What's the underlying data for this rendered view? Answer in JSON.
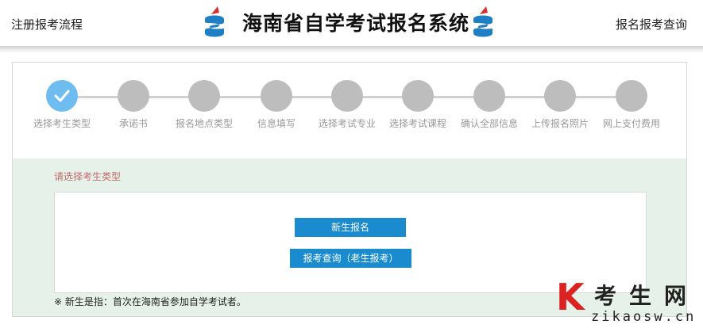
{
  "header": {
    "left_link": "注册报考流程",
    "title": "海南省自学考试报名系统",
    "right_link": "报名报考查询"
  },
  "steps": [
    {
      "label": "选择考生类型",
      "active": true
    },
    {
      "label": "承诺书",
      "active": false
    },
    {
      "label": "报名地点类型",
      "active": false
    },
    {
      "label": "信息填写",
      "active": false
    },
    {
      "label": "选择考试专业",
      "active": false
    },
    {
      "label": "选择考试课程",
      "active": false
    },
    {
      "label": "确认全部信息",
      "active": false
    },
    {
      "label": "上传报名照片",
      "active": false
    },
    {
      "label": "网上支付费用",
      "active": false
    }
  ],
  "content": {
    "hint": "请选择考生类型",
    "new_button": "新生报名",
    "query_button": "报考查询（老生报考）",
    "note": "※ 新生是指：首次在海南省参加自学考试者。"
  },
  "watermark": {
    "brand_letter": "K",
    "brand_cn": "考生网",
    "url": "zikaosw.cn"
  },
  "colors": {
    "step_active": "#6fbdf0",
    "step_inactive": "#bdbdbd",
    "button": "#1b8bd0",
    "content_bg": "#e6f2e9",
    "hint": "#c06a6a"
  }
}
